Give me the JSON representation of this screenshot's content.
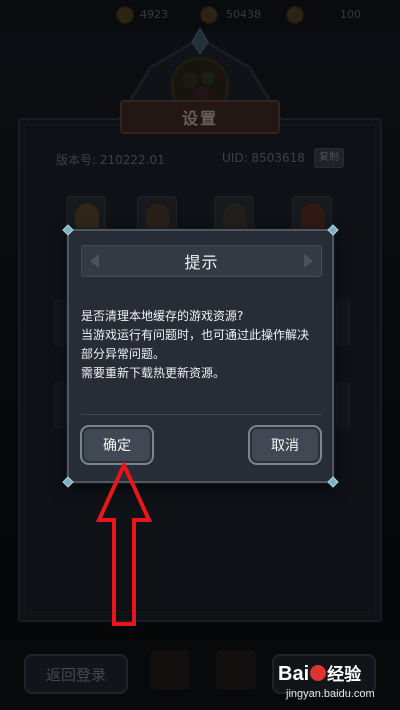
{
  "background": {
    "screen_title": "设置",
    "version_label": "版本号: 210222.01",
    "uid_label": "UID: 8503618",
    "copy_button": "复制",
    "back_button": "返回登录",
    "top_resources": [
      "4923",
      "50438",
      "100"
    ]
  },
  "dialog": {
    "title": "提示",
    "body_lines": [
      "是否清理本地缓存的游戏资源?",
      "当游戏运行有问题时，也可通过此操作解决",
      "部分异常问题。",
      "需要重新下载热更新资源。"
    ],
    "confirm_button": "确定",
    "cancel_button": "取消"
  },
  "annotation": {
    "arrow_color": "#e8151b",
    "arrow_icon": "up-arrow-outline-icon"
  },
  "watermark": {
    "brand": "Bai",
    "brand_suffix": "经验",
    "url": "jingyan.baidu.com"
  },
  "colors": {
    "dialog_bg": "#272d36",
    "dialog_border": "#4d5661",
    "accent_corner": "#7fb0c2"
  }
}
